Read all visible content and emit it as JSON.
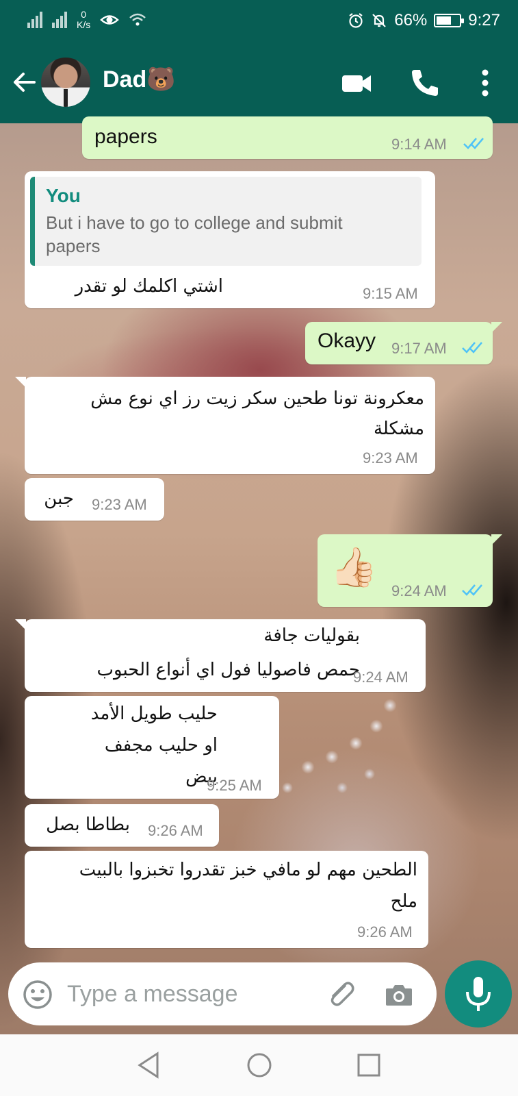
{
  "status_bar": {
    "net_speed_value": "0",
    "net_speed_unit": "K/s",
    "battery": "66%",
    "battery_level": 0.66,
    "time": "9:27"
  },
  "header": {
    "contact_name": "Dad🐻"
  },
  "messages": [
    {
      "direction": "outgoing",
      "text": "papers",
      "time": "9:14 AM",
      "ticks": "read"
    },
    {
      "direction": "incoming",
      "quote_author": "You",
      "quote_text": "But i have to go to college and submit papers",
      "text": "اشتي اكلمك لو تقدر",
      "time": "9:15 AM"
    },
    {
      "direction": "outgoing",
      "text": "Okayy",
      "time": "9:17 AM",
      "ticks": "read"
    },
    {
      "direction": "incoming",
      "text": "معكرونة تونا طحين سكر زيت رز اي نوع مش مشكلة",
      "time": "9:23 AM"
    },
    {
      "direction": "incoming",
      "text": "جبن",
      "time": "9:23 AM"
    },
    {
      "direction": "outgoing",
      "text": "👍🏻",
      "time": "9:24 AM",
      "ticks": "read"
    },
    {
      "direction": "incoming",
      "text_line1": "بقوليات جافة",
      "text_line2": "حمص فاصوليا فول اي أنواع الحبوب",
      "time": "9:24 AM"
    },
    {
      "direction": "incoming",
      "text_line1": "حليب طويل الأمد",
      "text_line2": "او حليب مجفف",
      "text_line3": "بيض",
      "time": "9:25 AM"
    },
    {
      "direction": "incoming",
      "text": "بطاطا بصل",
      "time": "9:26 AM"
    },
    {
      "direction": "incoming",
      "text_line1": "الطحين مهم لو مافي خبز تقدروا تخبزوا بالبيت",
      "text_line2": "ملح",
      "time": "9:26 AM"
    }
  ],
  "composer": {
    "placeholder": "Type a message"
  },
  "colors": {
    "header": "#075e54",
    "outgoing_bubble": "#dcf8c6",
    "incoming_bubble": "#ffffff",
    "accent": "#128c7e",
    "read_ticks": "#4fc3f7"
  }
}
